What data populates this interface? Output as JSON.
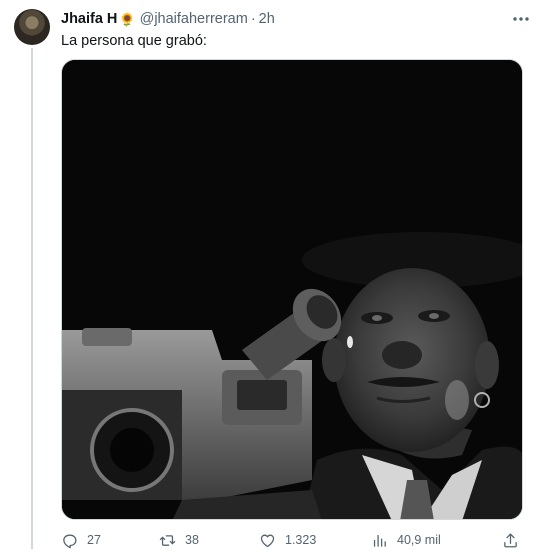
{
  "tweet": {
    "display_name": "Jhaifa H",
    "name_emoji": "🌻",
    "handle": "@jhaifaherreram",
    "separator": "·",
    "time": "2h",
    "text": "La persona que grabó:"
  },
  "actions": {
    "reply_count": "27",
    "retweet_count": "38",
    "like_count": "1.323",
    "views_count": "40,9 mil"
  },
  "icons": {
    "more": "more-icon",
    "reply": "reply-icon",
    "retweet": "retweet-icon",
    "like": "heart-icon",
    "views": "views-icon",
    "share": "share-icon"
  },
  "colors": {
    "text": "#0f1419",
    "secondary": "#536471",
    "border": "#cfd9de",
    "media_background": "#070707"
  }
}
